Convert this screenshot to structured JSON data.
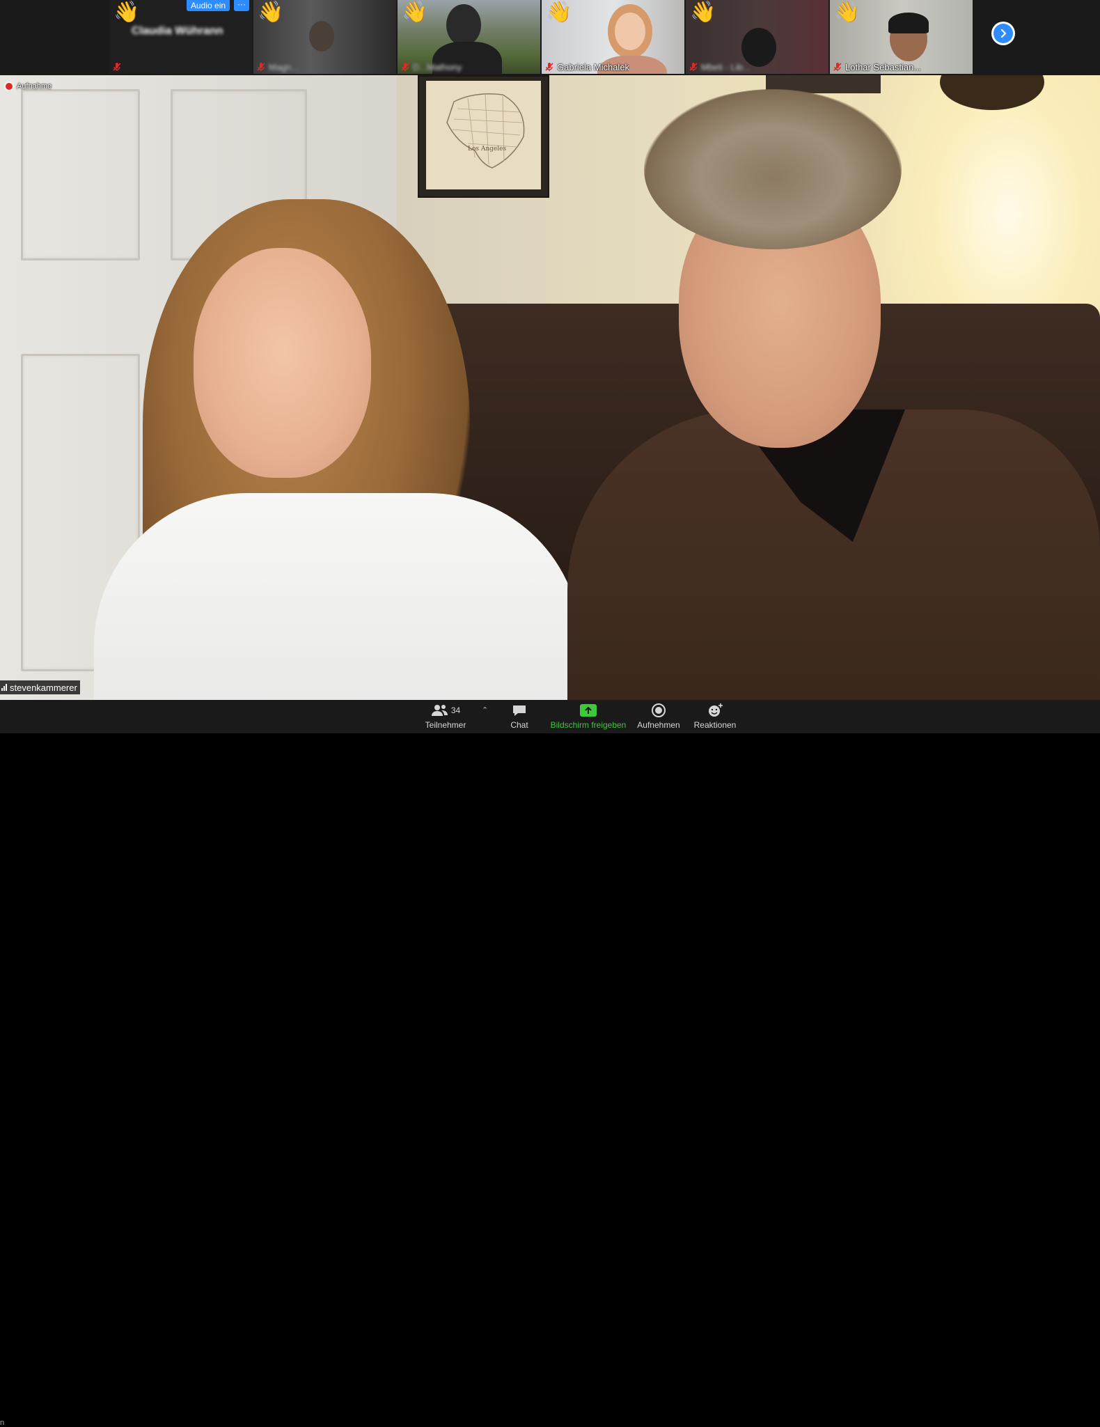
{
  "strip": {
    "tiles": [
      {
        "name": "Claudia Wührann",
        "raised_hand": true,
        "muted": true,
        "blurred": true
      },
      {
        "name": "Magn...",
        "raised_hand": true,
        "muted": true,
        "blurred": true
      },
      {
        "name": "D...Mathony",
        "raised_hand": true,
        "muted": true,
        "blurred": true
      },
      {
        "name": "Gabriela Michalek",
        "raised_hand": true,
        "muted": true,
        "blurred": false
      },
      {
        "name": "Mbeli - Lib...",
        "raised_hand": true,
        "muted": true,
        "blurred": true
      },
      {
        "name": "Lothar Sebastian...",
        "raised_hand": true,
        "muted": true,
        "blurred": false
      }
    ],
    "audio_button_label": "Audio ein",
    "more_button_label": "···",
    "next_page_icon": "chevron-right-icon"
  },
  "main": {
    "recording_label": "Aufnahme",
    "active_speaker_name": "stevenkammerer",
    "frame_caption": "Los Angeles"
  },
  "toolbar": {
    "participants_label": "Teilnehmer",
    "participants_count": "34",
    "chat_label": "Chat",
    "share_label": "Bildschirm freigeben",
    "record_label": "Aufnehmen",
    "reactions_label": "Reaktionen"
  },
  "colors": {
    "accent_blue": "#2d8cff",
    "share_green": "#3ec83a",
    "muted_red": "#e02828",
    "toolbar_bg": "#1a1a1a"
  }
}
